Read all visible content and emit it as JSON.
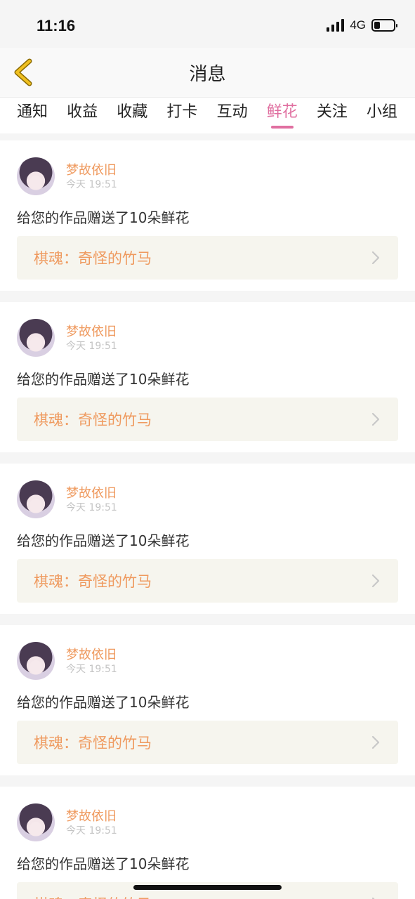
{
  "status_bar": {
    "time": "11:16",
    "network": "4G",
    "battery_level": 0.3
  },
  "header": {
    "title": "消息",
    "back_icon": "chevron-left-icon",
    "accent_color": "#f0c020"
  },
  "tabs": [
    {
      "label": "通知",
      "active": false
    },
    {
      "label": "收益",
      "active": false
    },
    {
      "label": "收藏",
      "active": false
    },
    {
      "label": "打卡",
      "active": false
    },
    {
      "label": "互动",
      "active": false
    },
    {
      "label": "鲜花",
      "active": true
    },
    {
      "label": "关注",
      "active": false
    },
    {
      "label": "小组",
      "active": false
    }
  ],
  "colors": {
    "active_tab": "#e06fa0",
    "author": "#ef9a5f",
    "work_link_bg": "#f6f5ee"
  },
  "messages": [
    {
      "author": "梦故依旧",
      "time": "今天 19:51",
      "text": "给您的作品赠送了10朵鲜花",
      "work_label": "棋魂：",
      "work_title": "奇怪的竹马"
    },
    {
      "author": "梦故依旧",
      "time": "今天 19:51",
      "text": "给您的作品赠送了10朵鲜花",
      "work_label": "棋魂：",
      "work_title": "奇怪的竹马"
    },
    {
      "author": "梦故依旧",
      "time": "今天 19:51",
      "text": "给您的作品赠送了10朵鲜花",
      "work_label": "棋魂：",
      "work_title": "奇怪的竹马"
    },
    {
      "author": "梦故依旧",
      "time": "今天 19:51",
      "text": "给您的作品赠送了10朵鲜花",
      "work_label": "棋魂：",
      "work_title": "奇怪的竹马"
    },
    {
      "author": "梦故依旧",
      "time": "今天 19:51",
      "text": "给您的作品赠送了10朵鲜花",
      "work_label": "棋魂：",
      "work_title": "奇怪的竹马"
    }
  ]
}
